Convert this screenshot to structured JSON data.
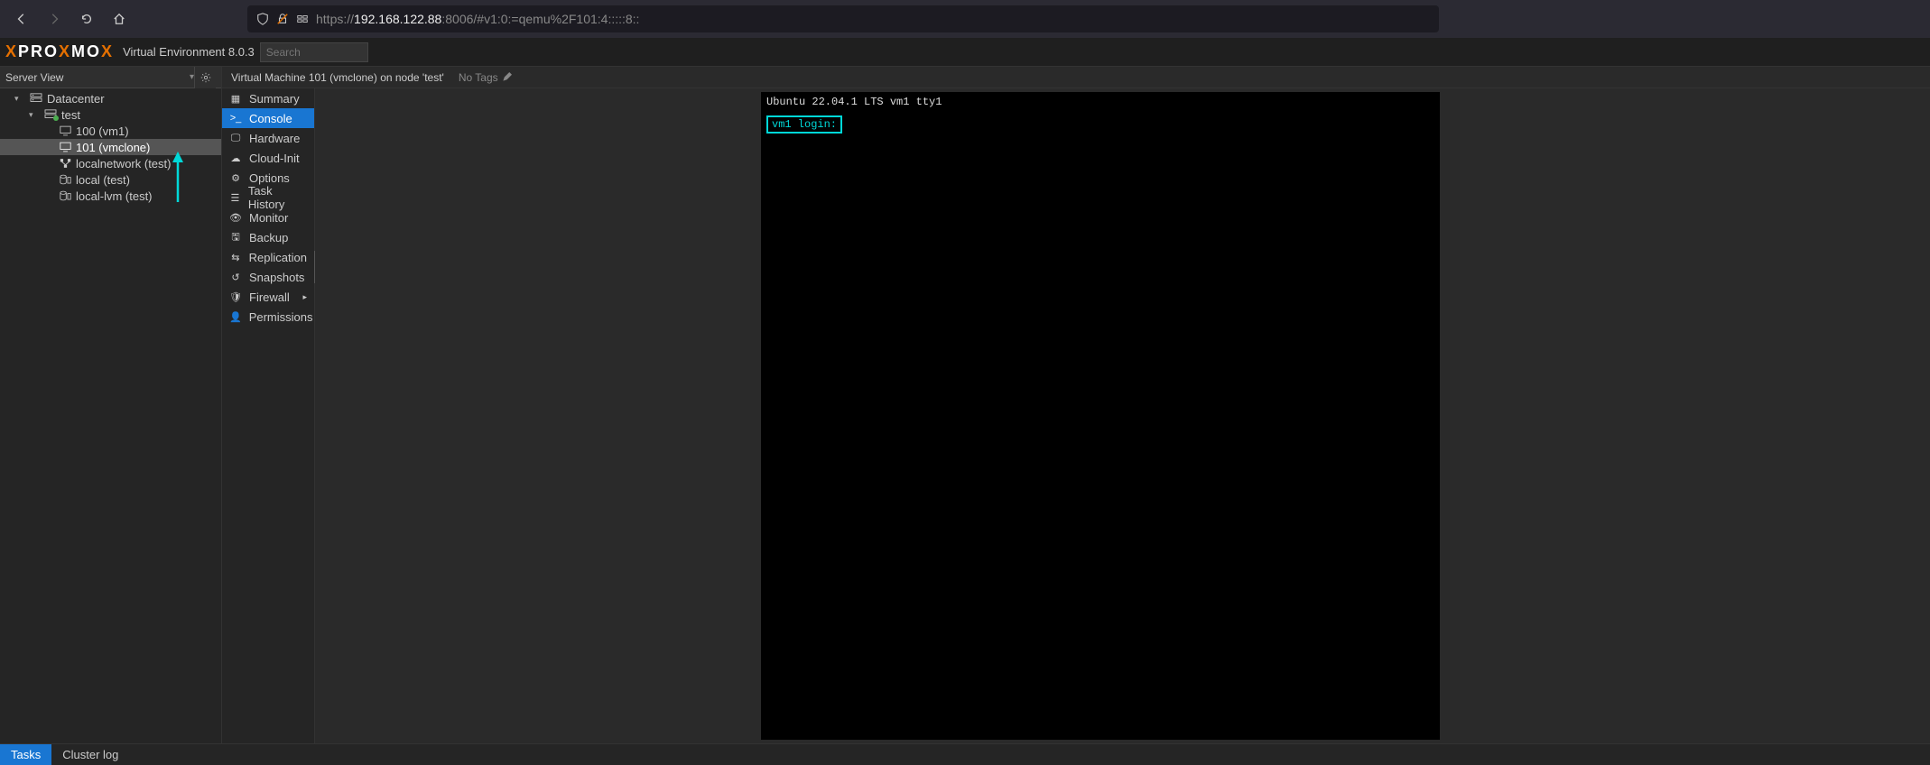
{
  "browser": {
    "url_prefix": "https://",
    "url_host": "192.168.122.88",
    "url_path": ":8006/#v1:0:=qemu%2F101:4:::::8::"
  },
  "header": {
    "version_label": "Virtual Environment 8.0.3",
    "search_placeholder": "Search"
  },
  "sidebar": {
    "view_label": "Server View",
    "tree": {
      "root": "Datacenter",
      "node": "test",
      "vm1": "100 (vm1)",
      "vm2": "101 (vmclone)",
      "net": "localnetwork (test)",
      "storage1": "local (test)",
      "storage2": "local-lvm (test)"
    }
  },
  "content": {
    "title": "Virtual Machine 101 (vmclone) on node 'test'",
    "no_tags": "No Tags"
  },
  "submenu": {
    "items": [
      {
        "label": "Summary",
        "icon": "book"
      },
      {
        "label": "Console",
        "icon": "terminal",
        "active": true
      },
      {
        "label": "Hardware",
        "icon": "desktop"
      },
      {
        "label": "Cloud-Init",
        "icon": "cloud"
      },
      {
        "label": "Options",
        "icon": "gear"
      },
      {
        "label": "Task History",
        "icon": "list"
      },
      {
        "label": "Monitor",
        "icon": "eye"
      },
      {
        "label": "Backup",
        "icon": "save"
      },
      {
        "label": "Replication",
        "icon": "retweet"
      },
      {
        "label": "Snapshots",
        "icon": "history"
      },
      {
        "label": "Firewall",
        "icon": "shield",
        "chevron": true
      },
      {
        "label": "Permissions",
        "icon": "user"
      }
    ]
  },
  "console": {
    "line1": "Ubuntu 22.04.1 LTS vm1 tty1",
    "login": "vm1 login:"
  },
  "footer": {
    "tab1": "Tasks",
    "tab2": "Cluster log"
  }
}
